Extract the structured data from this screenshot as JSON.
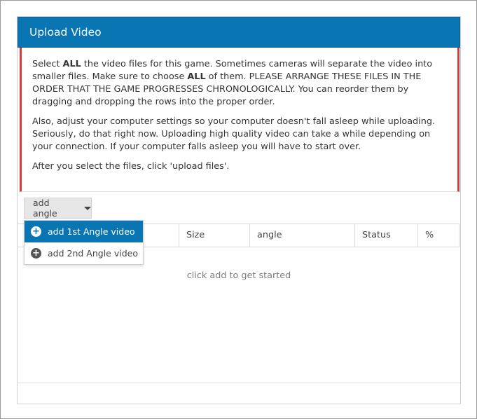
{
  "dialog": {
    "title": "Upload Video"
  },
  "notice": {
    "p1_a": "Select ",
    "p1_b1": "ALL",
    "p1_c": " the video files for this game. Sometimes cameras will separate the video into smaller files. Make sure to choose ",
    "p1_b2": "ALL",
    "p1_d": " of them. PLEASE ARRANGE THESE FILES IN THE ORDER THAT THE GAME PROGRESSES CHRONOLOGICALLY. You can reorder them by dragging and dropping the rows into the proper order.",
    "p2": "Also, adjust your computer settings so your computer doesn't fall asleep while uploading. Seriously, do that right now. Uploading high quality video can take a while depending on your connection. If your computer falls asleep you will have to start over.",
    "p3": "After you select the files, click 'upload files'."
  },
  "toolbar": {
    "add_angle_label": "add angle",
    "caret_icon": "caret-down-icon"
  },
  "dropdown": {
    "items": [
      {
        "label": "add 1st Angle video",
        "icon": "plus-circle-icon",
        "active": true
      },
      {
        "label": "add 2nd Angle video",
        "icon": "plus-circle-icon",
        "active": false
      }
    ]
  },
  "table": {
    "columns": [
      "Size",
      "angle",
      "Status",
      "%"
    ],
    "empty_message": "click add to get started"
  },
  "colors": {
    "header_bg": "#0a75b3",
    "notice_border": "#d23f3f"
  }
}
